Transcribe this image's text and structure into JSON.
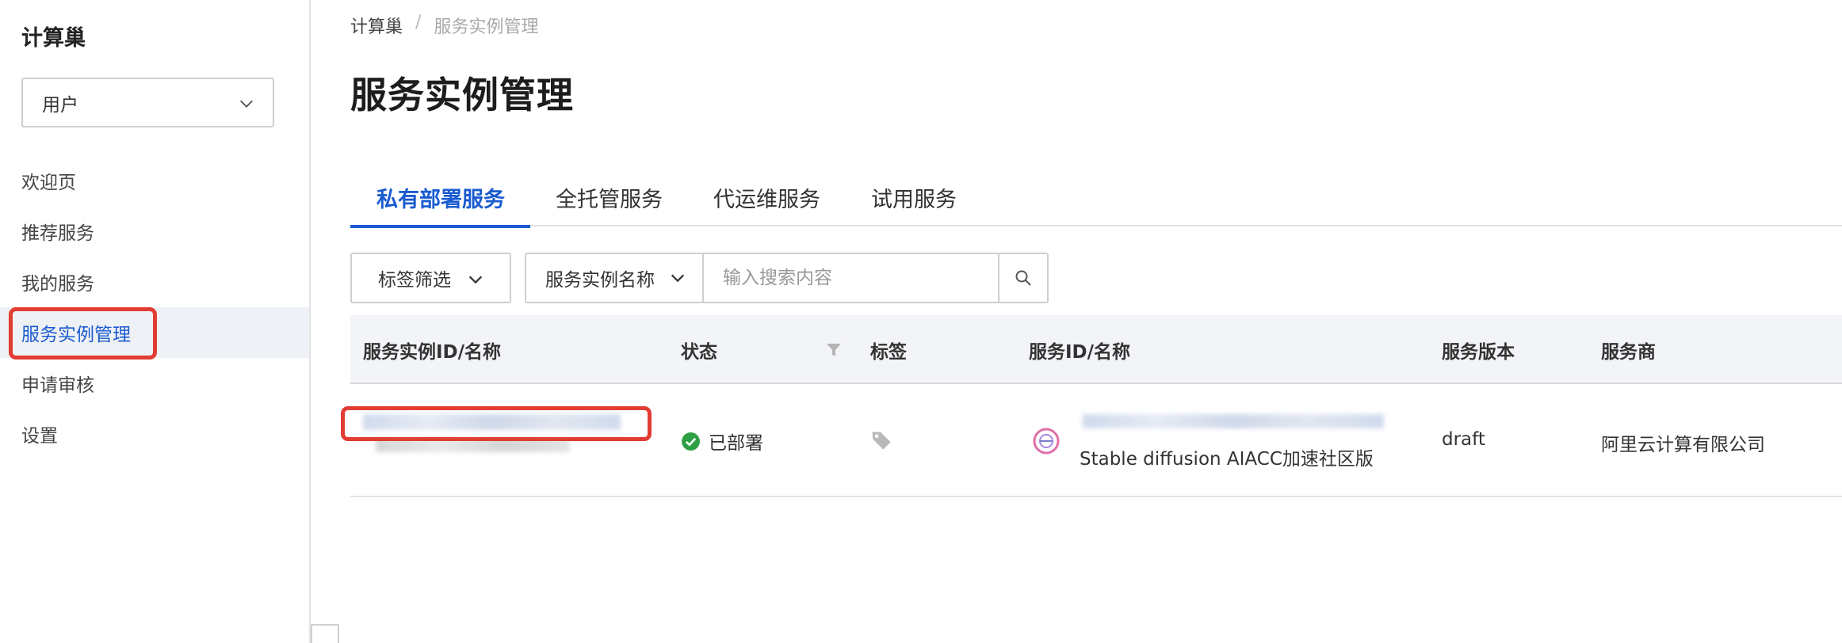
{
  "sidebar": {
    "title": "计算巢",
    "role_select": "用户",
    "items": [
      {
        "label": "欢迎页"
      },
      {
        "label": "推荐服务"
      },
      {
        "label": "我的服务"
      },
      {
        "label": "服务实例管理"
      },
      {
        "label": "申请审核"
      },
      {
        "label": "设置"
      }
    ]
  },
  "breadcrumb": {
    "root": "计算巢",
    "separator": "/",
    "current": "服务实例管理"
  },
  "page_title": "服务实例管理",
  "tabs": [
    {
      "label": "私有部署服务"
    },
    {
      "label": "全托管服务"
    },
    {
      "label": "代运维服务"
    },
    {
      "label": "试用服务"
    }
  ],
  "toolbar": {
    "tag_filter_label": "标签筛选",
    "search_type_label": "服务实例名称",
    "search_placeholder": "输入搜索内容"
  },
  "table": {
    "columns": {
      "instance": "服务实例ID/名称",
      "status": "状态",
      "tags": "标签",
      "service": "服务ID/名称",
      "version": "服务版本",
      "vendor": "服务商"
    },
    "rows": [
      {
        "status": "已部署",
        "service_name": "Stable diffusion AIACC加速社区版",
        "version": "draft",
        "vendor": "阿里云计算有限公司"
      }
    ]
  },
  "colors": {
    "accent": "#1a5bd0",
    "highlight": "#e23d33",
    "success": "#2ea043"
  },
  "icons": {
    "dropdown": "chevron-down-icon",
    "search": "search-icon",
    "filter": "filter-icon",
    "tag": "tag-icon",
    "status": "check-circle-icon",
    "service_logo": "service-logo-icon"
  }
}
